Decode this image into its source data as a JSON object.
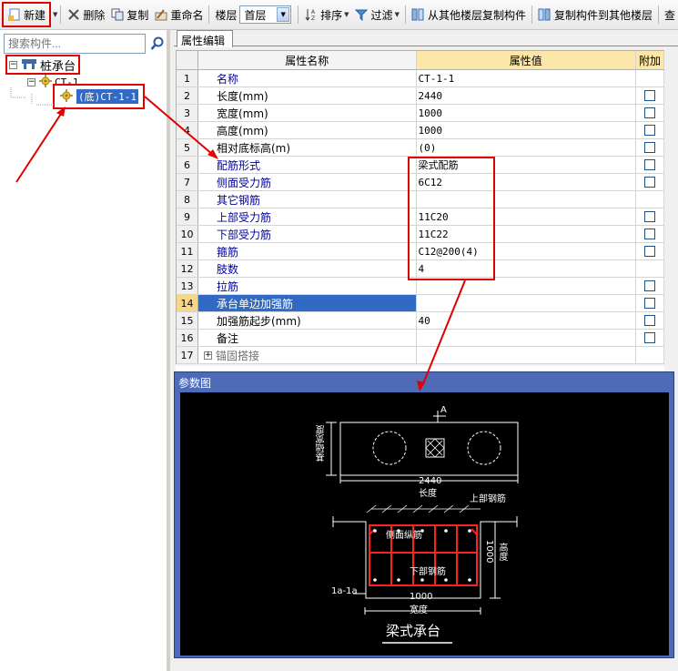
{
  "toolbar": {
    "new_label": "新建",
    "delete_label": "删除",
    "copy_label": "复制",
    "rename_label": "重命名",
    "floor_label": "楼层",
    "floor_value": "首层",
    "sort_label": "排序",
    "filter_label": "过滤",
    "copy_from_floor_label": "从其他楼层复制构件",
    "copy_to_floor_label": "复制构件到其他楼层",
    "overflow_label": "查"
  },
  "sidebar": {
    "search_placeholder": "搜索构件...",
    "root_label": "桩承台",
    "group_label": "CT-1",
    "selected_label": "(底)CT-1-1"
  },
  "tabs": {
    "properties": "属性编辑"
  },
  "grid": {
    "headers": {
      "name": "属性名称",
      "value": "属性值",
      "extra": "附加"
    },
    "rows": [
      {
        "num": "1",
        "name": "名称",
        "value": "CT-1-1"
      },
      {
        "num": "2",
        "name": "长度(mm)",
        "value": "2440"
      },
      {
        "num": "3",
        "name": "宽度(mm)",
        "value": "1000"
      },
      {
        "num": "4",
        "name": "高度(mm)",
        "value": "1000"
      },
      {
        "num": "5",
        "name": "相对底标高(m)",
        "value": "(0)"
      },
      {
        "num": "6",
        "name": "配筋形式",
        "value": "梁式配筋"
      },
      {
        "num": "7",
        "name": "侧面受力筋",
        "value": "6C12"
      },
      {
        "num": "8",
        "name": "其它钢筋",
        "value": ""
      },
      {
        "num": "9",
        "name": "上部受力筋",
        "value": "11C20"
      },
      {
        "num": "10",
        "name": "下部受力筋",
        "value": "11C22"
      },
      {
        "num": "11",
        "name": "箍筋",
        "value": "C12@200(4)"
      },
      {
        "num": "12",
        "name": "肢数",
        "value": "4"
      },
      {
        "num": "13",
        "name": "拉筋",
        "value": ""
      },
      {
        "num": "14",
        "name": "承台单边加强筋",
        "value": ""
      },
      {
        "num": "15",
        "name": "加强筋起步(mm)",
        "value": "40"
      },
      {
        "num": "16",
        "name": "备注",
        "value": ""
      },
      {
        "num": "17",
        "name": "锚固搭接",
        "value": ""
      }
    ]
  },
  "diagram": {
    "panel_title": "参数图",
    "label_a": "A",
    "label_width_side": "基础宽度",
    "dim_length_value": "2440",
    "dim_length_label": "长度",
    "label_top_rebar": "上部钢筋",
    "label_side_rebar": "侧面纵筋",
    "label_bottom_rebar": "下部钢筋",
    "dim_height_value": "1000",
    "dim_height_label": "高度",
    "label_section": "1a-1a",
    "dim_width_value": "1000",
    "dim_width_label": "宽度",
    "caption": "梁式承台"
  },
  "colors": {
    "annotation_red": "#e00000",
    "selection_blue": "#316ac5",
    "header_gold": "#fce6a8"
  }
}
